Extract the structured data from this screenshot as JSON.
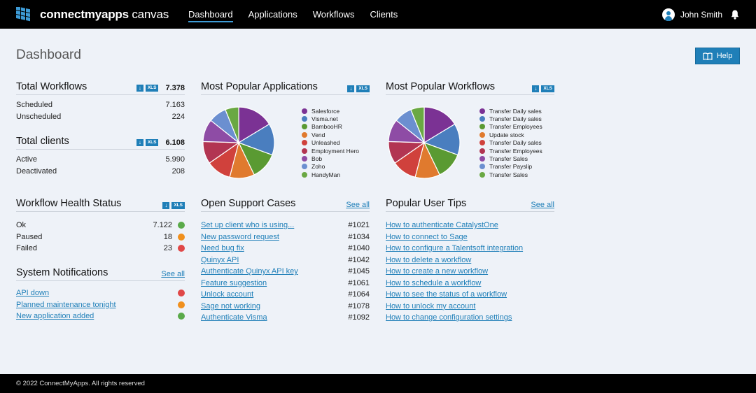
{
  "app": {
    "logo_bold": "connectmyapps",
    "logo_light": " canvas",
    "nav": [
      "Dashboard",
      "Applications",
      "Workflows",
      "Clients"
    ],
    "user_name": "John Smith"
  },
  "page": {
    "title": "Dashboard",
    "help_label": "Help"
  },
  "export": {
    "download_icon": "↓",
    "xls_label": "XLS"
  },
  "total_workflows": {
    "title": "Total Workflows",
    "total": "7.378",
    "rows": [
      {
        "label": "Scheduled",
        "value": "7.163"
      },
      {
        "label": "Unscheduled",
        "value": "224"
      }
    ]
  },
  "total_clients": {
    "title": "Total clients",
    "total": "6.108",
    "rows": [
      {
        "label": "Active",
        "value": "5.990"
      },
      {
        "label": "Deactivated",
        "value": "208"
      }
    ]
  },
  "health": {
    "title": "Workflow Health Status",
    "rows": [
      {
        "label": "Ok",
        "value": "7.122",
        "color": "#5aaa4a"
      },
      {
        "label": "Paused",
        "value": "18",
        "color": "#f0901e"
      },
      {
        "label": "Failed",
        "value": "23",
        "color": "#e04848"
      }
    ]
  },
  "notifications": {
    "title": "System Notifications",
    "see_all": "See all",
    "items": [
      {
        "label": "API down",
        "color": "#e04848"
      },
      {
        "label": "Planned maintenance tonight",
        "color": "#f0901e"
      },
      {
        "label": "New application added",
        "color": "#5aaa4a"
      }
    ]
  },
  "popular_apps": {
    "title": "Most Popular Applications",
    "legend": [
      "Salesforce",
      "Visma.net",
      "BambooHR",
      "Vend",
      "Unleashed",
      "Employment Hero",
      "Bob",
      "Zoho",
      "HandyMan"
    ]
  },
  "popular_workflows": {
    "title": "Most Popular Workflows",
    "legend": [
      "Transfer Daily sales",
      "Transfer Daily sales",
      "Transfer Employees",
      "Update stock",
      "Transfer Daily sales",
      "Transfer Employees",
      "Transfer Sales",
      "Transfer Payslip",
      "Transfer Sales"
    ]
  },
  "support": {
    "title": "Open Support Cases",
    "see_all": "See all",
    "items": [
      {
        "label": "Set up client who is using...",
        "id": "#1021"
      },
      {
        "label": "New password request",
        "id": "#1034"
      },
      {
        "label": "Need bug fix",
        "id": "#1040"
      },
      {
        "label": "Quinyx API",
        "id": "#1042"
      },
      {
        "label": "Authenticate Quinyx API key",
        "id": "#1045"
      },
      {
        "label": "Feature suggestion",
        "id": "#1061"
      },
      {
        "label": "Unlock account",
        "id": "#1064"
      },
      {
        "label": "Sage not working",
        "id": "#1078"
      },
      {
        "label": "Authenticate Visma",
        "id": "#1092"
      }
    ]
  },
  "tips": {
    "title": "Popular User Tips",
    "see_all": "See all",
    "items": [
      "How to authenticate CatalystOne",
      "How to connect to Sage",
      "How to configure a Talentsoft integration",
      "How to delete a workflow",
      "How to create a new workflow",
      "How to schedule a workflow",
      "How to see the status of a workflow",
      "How to unlock my account",
      "How to change configuration settings"
    ]
  },
  "chart_data": [
    {
      "type": "pie",
      "categories": [
        "Salesforce",
        "Visma.net",
        "BambooHR",
        "Vend",
        "Unleashed",
        "Employment Hero",
        "Bob",
        "Zoho",
        "HandyMan"
      ],
      "values": [
        16,
        14,
        12,
        11,
        11,
        10,
        10,
        8,
        6
      ],
      "colors": [
        "#7b3294",
        "#4a7ebf",
        "#5a9a32",
        "#e07a2e",
        "#d0413c",
        "#b23552",
        "#8e4ca5",
        "#6b8fd0",
        "#6aa843"
      ]
    },
    {
      "type": "pie",
      "categories": [
        "Transfer Daily sales",
        "Transfer Daily sales",
        "Transfer Employees",
        "Update stock",
        "Transfer Daily sales",
        "Transfer Employees",
        "Transfer Sales",
        "Transfer Payslip",
        "Transfer Sales"
      ],
      "values": [
        16,
        14,
        12,
        11,
        11,
        10,
        10,
        8,
        6
      ],
      "colors": [
        "#7b3294",
        "#4a7ebf",
        "#5a9a32",
        "#e07a2e",
        "#d0413c",
        "#b23552",
        "#8e4ca5",
        "#6b8fd0",
        "#6aa843"
      ]
    }
  ]
}
